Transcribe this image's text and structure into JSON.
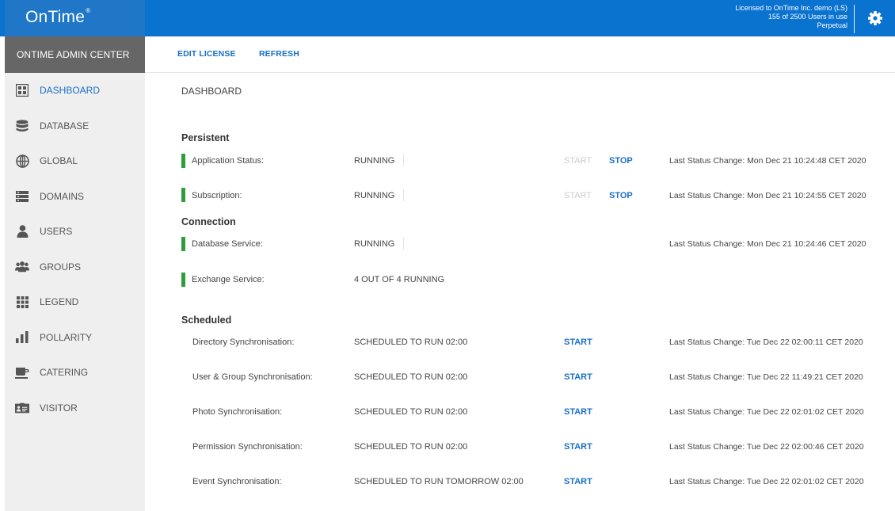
{
  "header": {
    "logo": "OnTime",
    "logo_mark": "®",
    "license_line1": "Licensed to OnTime Inc. demo (LS)",
    "license_line2": "155 of 2500 Users in use",
    "license_line3": "Perpetual",
    "settings_icon": "gear-icon",
    "colors": {
      "bar": "#0a72cf",
      "brand": "#2077c8"
    }
  },
  "sidebar": {
    "title": "ONTIME ADMIN CENTER",
    "items": [
      {
        "label": "DASHBOARD",
        "icon": "dashboard-icon",
        "active": true
      },
      {
        "label": "DATABASE",
        "icon": "database-icon"
      },
      {
        "label": "GLOBAL",
        "icon": "globe-icon"
      },
      {
        "label": "DOMAINS",
        "icon": "domains-icon"
      },
      {
        "label": "USERS",
        "icon": "user-icon"
      },
      {
        "label": "GROUPS",
        "icon": "groups-icon"
      },
      {
        "label": "LEGEND",
        "icon": "legend-icon"
      },
      {
        "label": "POLLARITY",
        "icon": "poll-icon"
      },
      {
        "label": "CATERING",
        "icon": "catering-icon"
      },
      {
        "label": "VISITOR",
        "icon": "visitor-icon"
      }
    ]
  },
  "toolbar": {
    "edit_license": "EDIT LICENSE",
    "refresh": "REFRESH"
  },
  "main": {
    "title": "DASHBOARD",
    "persistent": {
      "title": "Persistent",
      "rows": [
        {
          "label": "Application Status:",
          "status": "RUNNING",
          "start": "START",
          "stop": "STOP",
          "last_change": "Last Status Change: Mon Dec 21 10:24:48 CET 2020"
        },
        {
          "label": "Subscription:",
          "status": "RUNNING",
          "start": "START",
          "stop": "STOP",
          "last_change": "Last Status Change: Mon Dec 21 10:24:55 CET 2020"
        }
      ]
    },
    "connection": {
      "title": "Connection",
      "rows": [
        {
          "label": "Database Service:",
          "status": "RUNNING",
          "last_change": "Last Status Change: Mon Dec 21 10:24:46 CET 2020"
        },
        {
          "label": "Exchange Service:",
          "status": "4 OUT OF 4 RUNNING"
        }
      ]
    },
    "scheduled": {
      "title": "Scheduled",
      "rows": [
        {
          "label": "Directory Synchronisation:",
          "status": "SCHEDULED TO RUN 02:00",
          "start": "START",
          "last_change": "Last Status Change: Tue Dec 22 02:00:11 CET 2020"
        },
        {
          "label": "User & Group Synchronisation:",
          "status": "SCHEDULED TO RUN 02:00",
          "start": "START",
          "last_change": "Last Status Change: Tue Dec 22 11:49:21 CET 2020"
        },
        {
          "label": "Photo Synchronisation:",
          "status": "SCHEDULED TO RUN 02:00",
          "start": "START",
          "last_change": "Last Status Change: Tue Dec 22 02:01:02 CET 2020"
        },
        {
          "label": "Permission Synchronisation:",
          "status": "SCHEDULED TO RUN 02:00",
          "start": "START",
          "last_change": "Last Status Change: Tue Dec 22 02:00:46 CET 2020"
        },
        {
          "label": "Event Synchronisation:",
          "status": "SCHEDULED TO RUN TOMORROW 02:00",
          "start": "START",
          "last_change": "Last Status Change: Tue Dec 22 02:01:02 CET 2020"
        }
      ]
    },
    "colors": {
      "accent": "#1a6fc4",
      "running": "#2e9e3a",
      "disabled": "#cccccc"
    }
  }
}
